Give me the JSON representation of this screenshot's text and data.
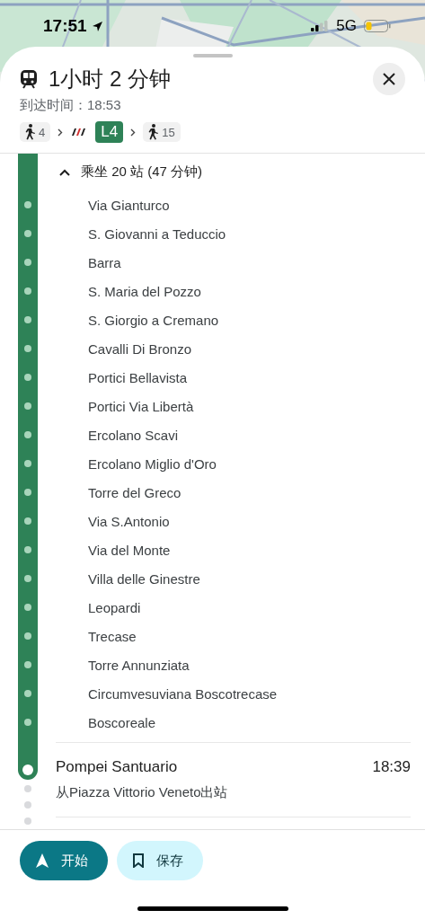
{
  "status_bar": {
    "time": "17:51",
    "network": "5G"
  },
  "header": {
    "duration": "1小时 2 分钟",
    "arrival": "到达时间：18:53"
  },
  "steps": [
    {
      "kind": "walk",
      "label": "4"
    },
    {
      "kind": "transit",
      "label": "L4"
    },
    {
      "kind": "walk",
      "label": "15"
    }
  ],
  "ride": {
    "summary": "乘坐 20 站 (47 分钟)",
    "expanded": true,
    "stops": [
      "Via Gianturco",
      "S. Giovanni a Teduccio",
      "Barra",
      "S. Maria del Pozzo",
      "S. Giorgio a Cremano",
      "Cavalli Di Bronzo",
      "Portici Bellavista",
      "Portici Via Libertà",
      "Ercolano Scavi",
      "Ercolano Miglio d'Oro",
      "Torre del Greco",
      "Via S.Antonio",
      "Via del Monte",
      "Villa delle Ginestre",
      "Leopardi",
      "Trecase",
      "Torre Annunziata",
      "Circumvesuviana Boscotrecase",
      "Boscoreale"
    ]
  },
  "arrival_stop": {
    "name": "Pompei Santuario",
    "time": "18:39",
    "exit": "从Piazza Vittorio Veneto出站"
  },
  "buttons": [
    {
      "kind": "primary",
      "label": "开始"
    },
    {
      "kind": "secondary",
      "label": "保存"
    }
  ]
}
